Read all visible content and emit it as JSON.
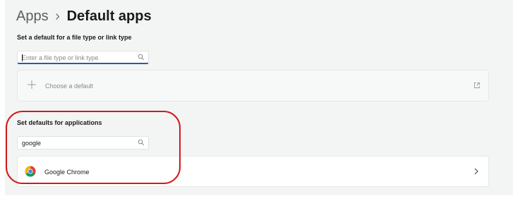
{
  "breadcrumb": {
    "parent": "Apps",
    "separator": "chevron-right-icon",
    "current": "Default apps"
  },
  "file_type_section": {
    "label": "Set a default for a file type or link type",
    "search": {
      "value": "",
      "placeholder": "Enter a file type or link type",
      "icon": "search-icon"
    },
    "choose_default": {
      "label": "Choose a default",
      "icon": "plus-icon",
      "action_icon": "external-link-icon"
    }
  },
  "applications_section": {
    "label": "Set defaults for applications",
    "search": {
      "value": "google",
      "placeholder": "",
      "icon": "search-icon"
    },
    "results": [
      {
        "name": "Google Chrome",
        "icon": "chrome-icon",
        "action_icon": "chevron-right-icon"
      }
    ]
  },
  "colors": {
    "background": "#f3f5f4",
    "card": "#ffffff",
    "accent_focus": "#1f5fad",
    "highlight_annotation": "#d11a1a"
  }
}
